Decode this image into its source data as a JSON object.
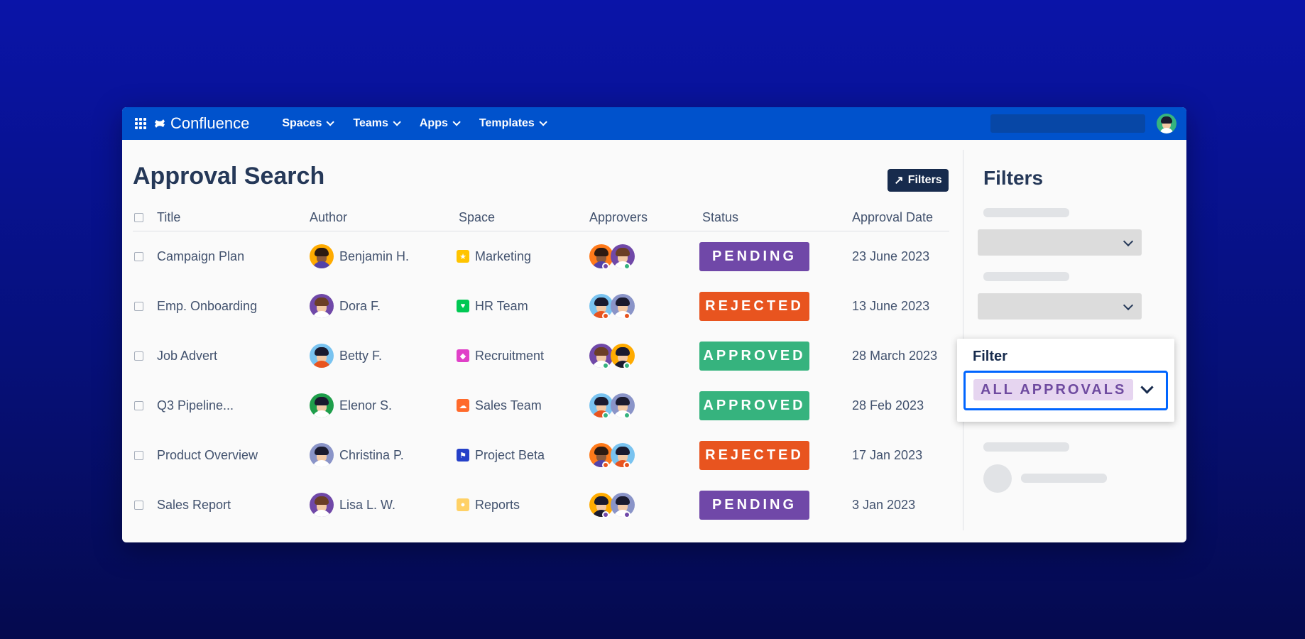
{
  "app": {
    "name": "Confluence",
    "nav": [
      {
        "label": "Spaces"
      },
      {
        "label": "Teams"
      },
      {
        "label": "Apps"
      },
      {
        "label": "Templates"
      }
    ]
  },
  "page": {
    "title": "Approval Search",
    "filters_button": "Filters"
  },
  "table": {
    "headers": {
      "title": "Title",
      "author": "Author",
      "space": "Space",
      "approvers": "Approvers",
      "status": "Status",
      "date": "Approval Date"
    },
    "rows": [
      {
        "title": "Campaign Plan",
        "author": "Benjamin H.",
        "space": "Marketing",
        "status": "PENDING",
        "date": "23 June 2023"
      },
      {
        "title": "Emp. Onboarding",
        "author": "Dora F.",
        "space": "HR Team",
        "status": "REJECTED",
        "date": "13 June 2023"
      },
      {
        "title": "Job Advert",
        "author": "Betty F.",
        "space": "Recruitment",
        "status": "APPROVED",
        "date": "28 March 2023"
      },
      {
        "title": "Q3 Pipeline...",
        "author": "Elenor S.",
        "space": "Sales Team",
        "status": "APPROVED",
        "date": "28 Feb 2023"
      },
      {
        "title": "Product Overview",
        "author": "Christina P.",
        "space": "Project Beta",
        "status": "REJECTED",
        "date": "17 Jan 2023"
      },
      {
        "title": "Sales Report",
        "author": "Lisa L. W.",
        "space": "Reports",
        "status": "PENDING",
        "date": "3 Jan 2023"
      }
    ]
  },
  "sidebar": {
    "title": "Filters"
  },
  "filter_popup": {
    "label": "Filter",
    "selected": "ALL APPROVALS"
  },
  "colors": {
    "pending": "#7048a8",
    "rejected": "#e8541f",
    "approved": "#36b37e",
    "topbar": "#0052cc"
  }
}
